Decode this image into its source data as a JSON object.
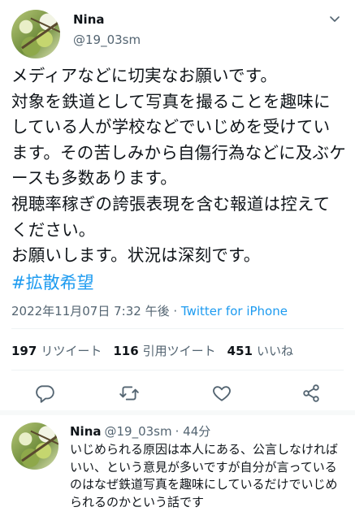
{
  "tweet": {
    "author_name": "Nina",
    "author_handle": "@19_03sm",
    "text": "メディアなどに切実なお願いです。\n対象を鉄道として写真を撮ることを趣味にしている人が学校などでいじめを受けています。その苦しみから自傷行為などに及ぶケースも多数あります。\n視聴率稼ぎの誇張表現を含む報道は控えてください。\nお願いします。状況は深刻です。",
    "hashtag": "#拡散希望",
    "timestamp": "2022年11月07日 7:32 午後",
    "separator": " · ",
    "client": "Twitter for iPhone"
  },
  "stats": {
    "retweets_count": "197",
    "retweets_label": "リツイート",
    "quotes_count": "116",
    "quotes_label": "引用ツイート",
    "likes_count": "451",
    "likes_label": "いいね"
  },
  "icons": {
    "more": "chevron-down-icon",
    "reply": "reply-icon",
    "retweet": "retweet-icon",
    "like": "heart-icon",
    "share": "share-icon"
  },
  "colors": {
    "link": "#1d9bf0",
    "secondary": "#536471",
    "text": "#0f1419"
  },
  "reply": {
    "author_name": "Nina",
    "author_handle": "@19_03sm",
    "time": "· 44分",
    "text": "いじめられる原因は本人にある、公言しなければいい、という意見が多いですが自分が言っているのはなぜ鉄道写真を趣味にしているだけでいじめられるのかという話です"
  }
}
